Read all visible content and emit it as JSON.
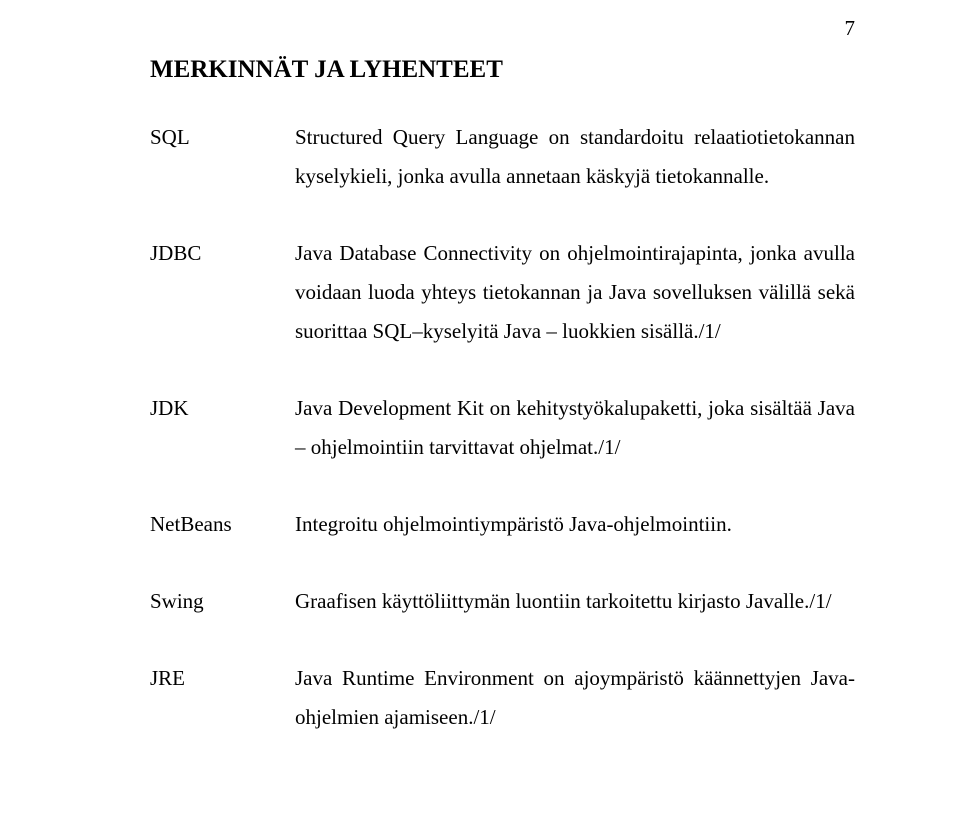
{
  "page_number": "7",
  "heading": "MERKINNÄT JA LYHENTEET",
  "entries": [
    {
      "term": "SQL",
      "definition": "Structured Query Language on standardoitu relaatiotietokannan kyselykieli, jonka avulla annetaan käskyjä tietokannalle."
    },
    {
      "term": "JDBC",
      "definition": "Java Database Connectivity on ohjelmointirajapinta, jonka avulla voidaan luoda yhteys tietokannan ja Java sovelluksen välillä sekä suorittaa SQL–kyselyitä Java – luokkien sisällä./1/"
    },
    {
      "term": "JDK",
      "definition": "Java Development Kit on kehitystyökalupaketti, joka sisältää Java – ohjelmointiin tarvittavat ohjelmat./1/"
    },
    {
      "term": "NetBeans",
      "definition": "Integroitu ohjelmointiympäristö Java-ohjelmointiin."
    },
    {
      "term": "Swing",
      "definition": "Graafisen käyttöliittymän luontiin tarkoitettu kirjasto Javalle./1/"
    },
    {
      "term": "JRE",
      "definition": "Java Runtime Environment on ajoympäristö käännettyjen Java-ohjelmien ajamiseen./1/"
    }
  ]
}
